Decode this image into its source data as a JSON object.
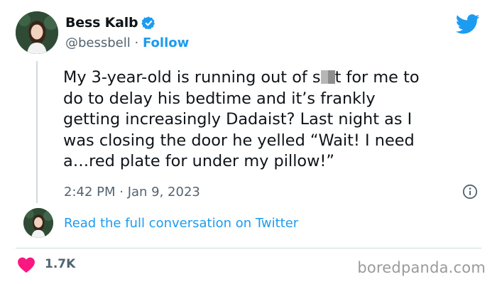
{
  "author": {
    "name": "Bess Kalb",
    "handle": "@bessbell",
    "separator": "·",
    "follow_label": "Follow",
    "verified": true
  },
  "tweet": {
    "text_before_censor": "My 3-year-old is running out of s",
    "text_after_censor": "t for me to\ndo to delay his bedtime and it’s frankly\ngetting increasingly Dadaist? Last night as I\nwas closing the door he yelled “Wait! I need\na…red plate for under my pillow!”",
    "timestamp": "2:42 PM · Jan 9, 2023"
  },
  "conversation_link": "Read the full conversation on Twitter",
  "likes": {
    "count": "1.7K"
  },
  "watermark": "boredpanda.com",
  "icons": {
    "brand": "twitter-bird-icon",
    "verified": "verified-badge-icon",
    "info": "info-icon",
    "like": "heart-icon"
  },
  "colors": {
    "link": "#1d9bf0",
    "secondary_text": "#536471",
    "heart": "#f91880",
    "twitter_blue": "#1d9bf0"
  }
}
